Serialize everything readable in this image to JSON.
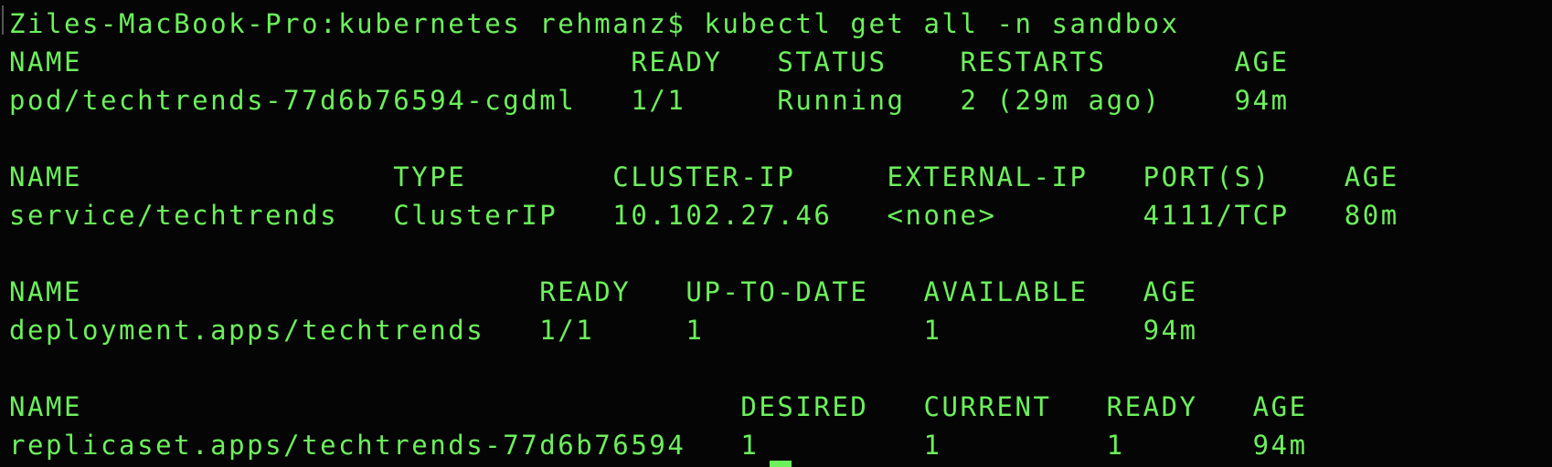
{
  "terminal": {
    "colors": {
      "background": "#050505",
      "text": "#6CF05C"
    },
    "lines": [
      "Ziles-MacBook-Pro:kubernetes rehmanz$ kubectl get all -n sandbox",
      "NAME                              READY   STATUS    RESTARTS       AGE",
      "pod/techtrends-77d6b76594-cgdml   1/1     Running   2 (29m ago)    94m",
      "",
      "NAME                 TYPE        CLUSTER-IP     EXTERNAL-IP   PORT(S)    AGE",
      "service/techtrends   ClusterIP   10.102.27.46   <none>        4111/TCP   80m",
      "",
      "NAME                         READY   UP-TO-DATE   AVAILABLE   AGE",
      "deployment.apps/techtrends   1/1     1            1           94m",
      "",
      "NAME                                    DESIRED   CURRENT   READY   AGE",
      "replicaset.apps/techtrends-77d6b76594   1         1         1       94m"
    ]
  }
}
